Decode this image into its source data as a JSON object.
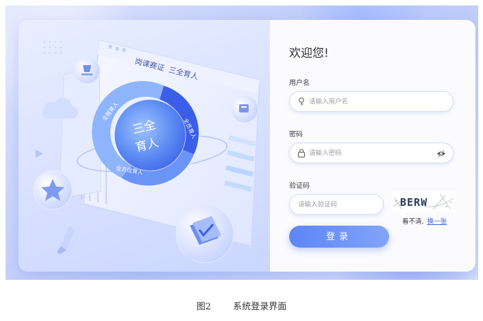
{
  "illustration": {
    "banner_text": "岗课赛证  三全育人",
    "center_text_line1": "三全",
    "center_text_line2": "育人",
    "ring_label_left": "全程育人",
    "ring_label_right": "全员育人",
    "ring_label_bottom": "全方位育人"
  },
  "login": {
    "welcome": "欢迎您!",
    "username_label": "用户名",
    "username_placeholder": "请输入用户名",
    "password_label": "密码",
    "password_placeholder": "请输入密码",
    "captcha_label": "验证码",
    "captcha_placeholder": "请输入验证码",
    "captcha_text": "BERW",
    "unclear_text": "看不清,",
    "refresh_link": "换一张",
    "submit_label": "登录"
  },
  "caption": {
    "figure": "图2",
    "title": "系统登录界面"
  },
  "colors": {
    "accent": "#5d86f5",
    "link": "#3b63d8",
    "ring_dark": "#3a5ee8"
  }
}
